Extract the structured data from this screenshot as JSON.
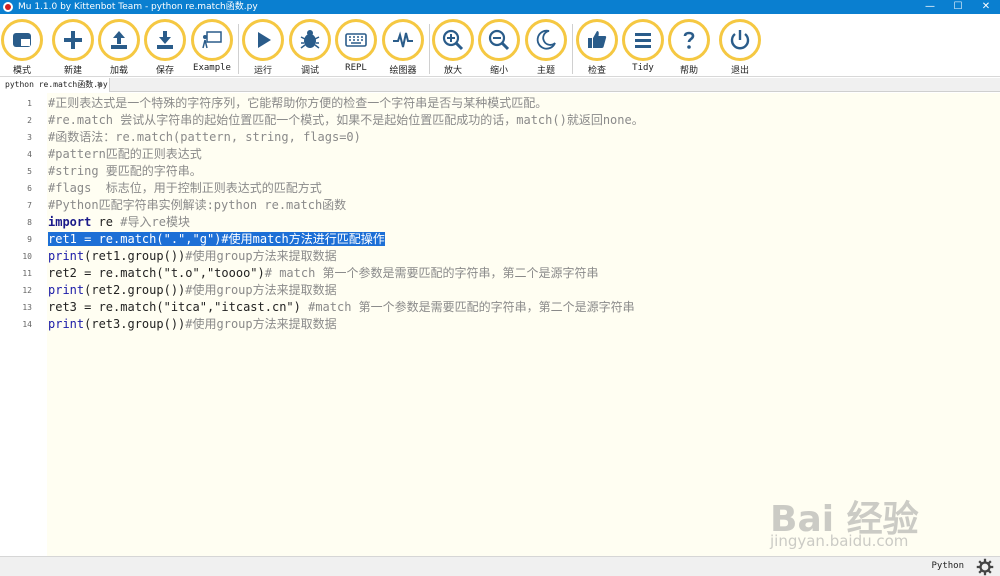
{
  "window": {
    "title": "Mu 1.1.0 by Kittenbot Team - python re.match函数.py",
    "controls": [
      "—",
      "☐",
      "✕"
    ]
  },
  "toolbar": {
    "buttons": [
      {
        "label": "模式",
        "icon": "mode-icon"
      },
      {
        "label": "新建",
        "icon": "plus-icon"
      },
      {
        "label": "加载",
        "icon": "upload-icon"
      },
      {
        "label": "保存",
        "icon": "download-icon"
      },
      {
        "label": "Example",
        "icon": "presentation-icon"
      },
      {
        "label": "运行",
        "icon": "play-icon"
      },
      {
        "label": "调试",
        "icon": "bug-icon"
      },
      {
        "label": "REPL",
        "icon": "keyboard-icon"
      },
      {
        "label": "绘图器",
        "icon": "pulse-icon"
      },
      {
        "label": "放大",
        "icon": "zoom-in-icon"
      },
      {
        "label": "缩小",
        "icon": "zoom-out-icon"
      },
      {
        "label": "主题",
        "icon": "moon-icon"
      },
      {
        "label": "检查",
        "icon": "thumbs-up-icon"
      },
      {
        "label": "Tidy",
        "icon": "lines-icon"
      },
      {
        "label": "帮助",
        "icon": "question-icon"
      },
      {
        "label": "退出",
        "icon": "power-icon"
      }
    ]
  },
  "tab": {
    "label": "python re.match函数.py",
    "close": "✖"
  },
  "editor": {
    "line_numbers": [
      "1",
      "2",
      "3",
      "4",
      "5",
      "6",
      "7",
      "8",
      "9",
      "10",
      "11",
      "12",
      "13",
      "14"
    ],
    "lines": [
      [
        {
          "t": "#正则表达式是一个特殊的字符序列，它能帮助你方便的检查一个字符串是否与某种模式匹配。",
          "c": "comment"
        }
      ],
      [
        {
          "t": "#re.match 尝试从字符串的起始位置匹配一个模式，如果不是起始位置匹配成功的话，match()就返回none。",
          "c": "comment"
        }
      ],
      [
        {
          "t": "#函数语法：re.match(pattern, string, flags=0)",
          "c": "comment"
        }
      ],
      [
        {
          "t": "#pattern匹配的正则表达式",
          "c": "comment"
        }
      ],
      [
        {
          "t": "#string 要匹配的字符串。",
          "c": "comment"
        }
      ],
      [
        {
          "t": "#flags  标志位，用于控制正则表达式的匹配方式",
          "c": "comment"
        }
      ],
      [
        {
          "t": "#Python匹配字符串实例解读:python re.match函数",
          "c": "comment"
        }
      ],
      [
        {
          "t": "import",
          "c": "kw"
        },
        {
          "t": " re ",
          "c": "plain"
        },
        {
          "t": "#导入re模块",
          "c": "comment"
        }
      ],
      [
        {
          "t": "ret1 = re.match(\".\",\"g\")#使用match方法进行匹配操作",
          "c": "sel"
        }
      ],
      [
        {
          "t": "print",
          "c": "fn"
        },
        {
          "t": "(ret1.group())",
          "c": "plain"
        },
        {
          "t": "#使用group方法来提取数据",
          "c": "comment"
        }
      ],
      [
        {
          "t": "ret2 = re.match(\"t.o\",\"toooo\")",
          "c": "plain"
        },
        {
          "t": "# match 第一个参数是需要匹配的字符串，第二个是源字符串",
          "c": "comment"
        }
      ],
      [
        {
          "t": "print",
          "c": "fn"
        },
        {
          "t": "(ret2.group())",
          "c": "plain"
        },
        {
          "t": "#使用group方法来提取数据",
          "c": "comment"
        }
      ],
      [
        {
          "t": "ret3 = re.match(\"itca\",\"itcast.cn\")",
          "c": "plain"
        },
        {
          "t": " #match 第一个参数是需要匹配的字符串，第二个是源字符串",
          "c": "comment"
        }
      ],
      [
        {
          "t": "print",
          "c": "fn"
        },
        {
          "t": "(ret3.group())",
          "c": "plain"
        },
        {
          "t": "#使用group方法来提取数据",
          "c": "comment"
        }
      ]
    ]
  },
  "status": {
    "mode": "Python",
    "settings_icon": "gear-icon"
  },
  "watermark": {
    "main": "Bai 经验",
    "sub": "jingyan.baidu.com"
  },
  "colors": {
    "titlebar": "#0a7fd0",
    "button_ring": "#f5c842",
    "editor_bg": "#fffef2",
    "selection": "#1d6fd6"
  }
}
